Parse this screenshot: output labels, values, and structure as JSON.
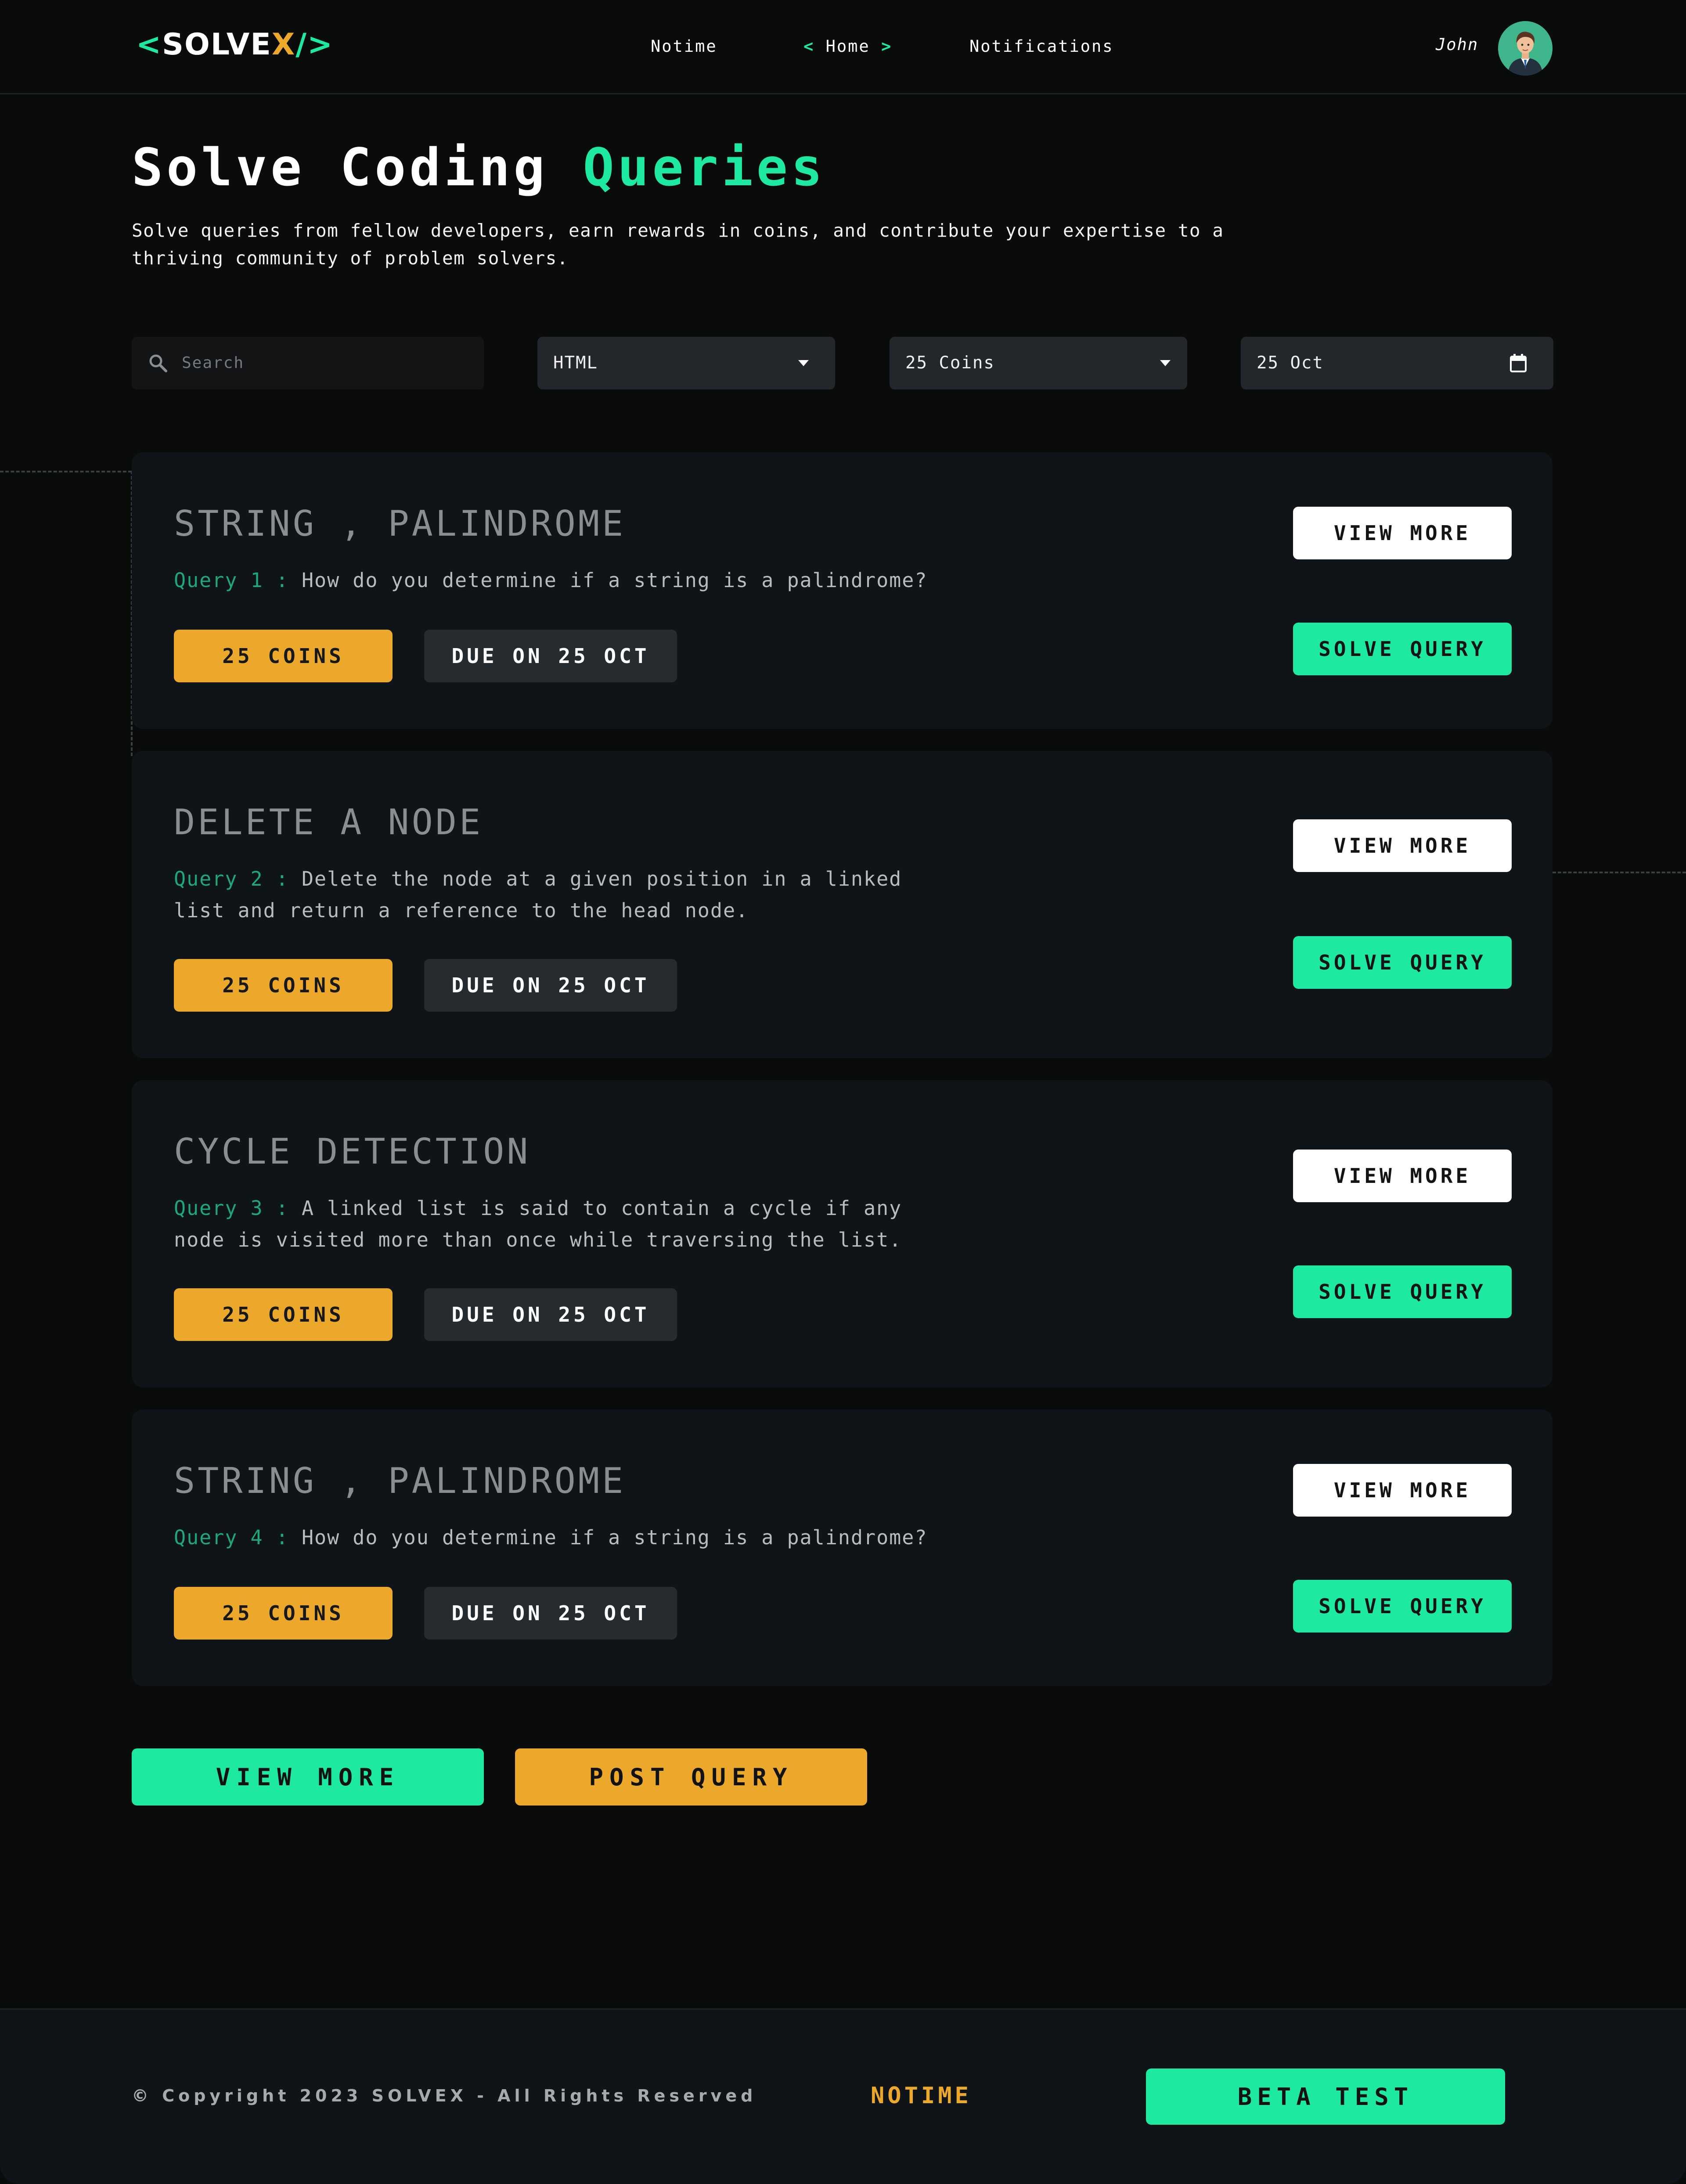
{
  "nav": {
    "logo_open": "<",
    "logo_solve": "SOLVE",
    "logo_x": "X",
    "logo_close": "/>",
    "links": {
      "notime": "Notime",
      "home_left": "<",
      "home": "Home",
      "home_right": ">",
      "notifications": "Notifications"
    },
    "username": "John",
    "avatar_icon": "user-avatar-icon"
  },
  "hero": {
    "title_part1": "Solve Coding",
    "title_part2": "Queries",
    "description": "Solve queries from fellow developers, earn rewards in coins, and contribute your expertise to a thriving community of problem solvers."
  },
  "filters": {
    "search_placeholder": "Search",
    "language": "HTML",
    "coins": "25 Coins",
    "date": "25 Oct"
  },
  "queries": [
    {
      "title": "STRING , PALINDROME",
      "query_label": "Query 1 :",
      "query_text": "How do you determine if a string is a palindrome?",
      "coins": "25 COINS",
      "due": "DUE ON 25 OCT",
      "view_more": "VIEW MORE",
      "solve": "SOLVE QUERY"
    },
    {
      "title": "DELETE A NODE",
      "query_label": "Query 2 :",
      "query_text": "Delete the node at a given position in a linked list and return a reference to the head node.",
      "coins": "25 COINS",
      "due": "DUE ON 25 OCT",
      "view_more": "VIEW MORE",
      "solve": "SOLVE QUERY"
    },
    {
      "title": "CYCLE DETECTION",
      "query_label": "Query 3 :",
      "query_text": "A linked list is said to contain a cycle if any node is visited more than once while traversing the list.",
      "coins": "25 COINS",
      "due": "DUE ON 25 OCT",
      "view_more": "VIEW MORE",
      "solve": "SOLVE QUERY"
    },
    {
      "title": "STRING , PALINDROME",
      "query_label": "Query 4 :",
      "query_text": "How do you determine if a string is a palindrome?",
      "coins": "25 COINS",
      "due": "DUE ON 25 OCT",
      "view_more": "VIEW MORE",
      "solve": "SOLVE QUERY"
    }
  ],
  "actions": {
    "view_more": "VIEW MORE",
    "post_query": "POST QUERY"
  },
  "footer": {
    "copyright": "© Copyright 2023 SOLVEX - All Rights Reserved",
    "brand": "NOTIME",
    "beta": "BETA TEST"
  },
  "colors": {
    "background": "#0a0b0b",
    "card": "#0e1418",
    "accent_green": "#1de9a0",
    "accent_orange": "#eba82a",
    "chip_dark": "#262b30"
  }
}
